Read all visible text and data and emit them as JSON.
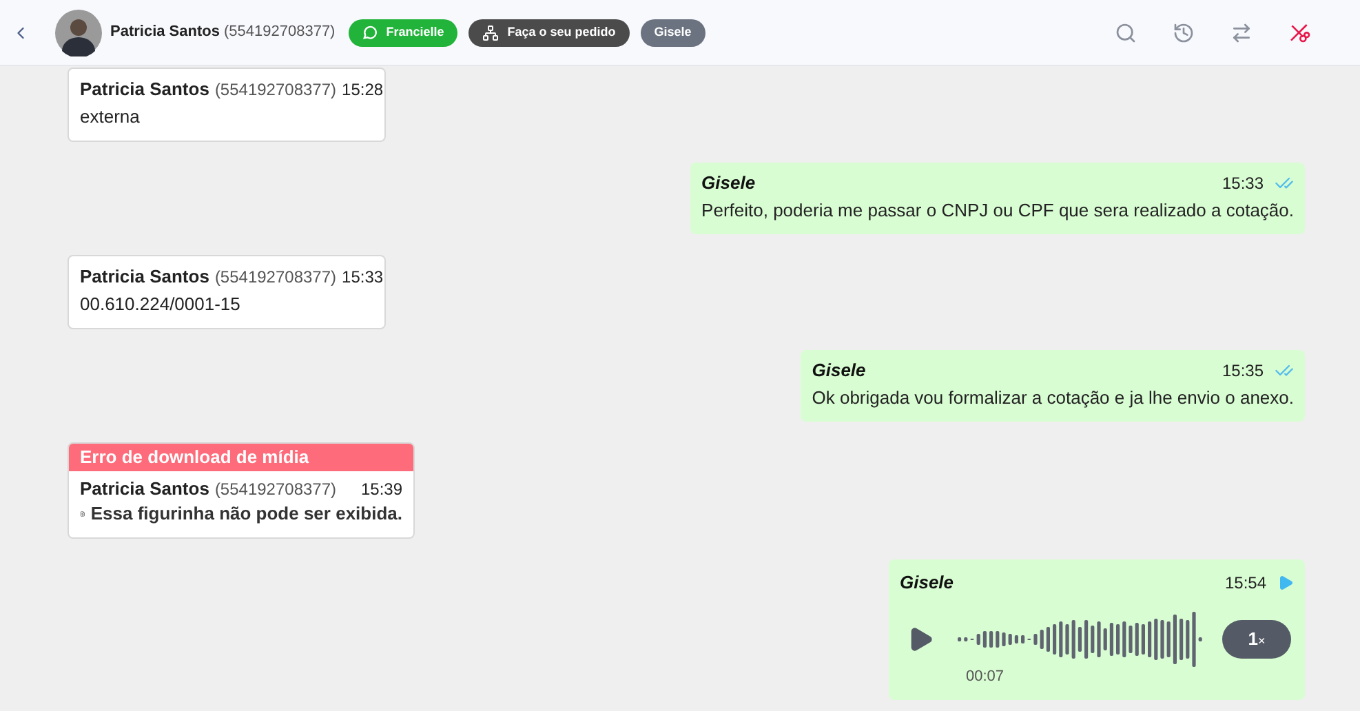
{
  "header": {
    "contact_name": "Patricia Santos",
    "contact_phone": "(554192708377)",
    "tags": [
      {
        "kind": "whatsapp",
        "label": "Francielle",
        "color": "#22b33a"
      },
      {
        "kind": "queue",
        "label": "Faça o seu pedido",
        "color": "#4b4b4b"
      },
      {
        "kind": "plain",
        "label": "Gisele",
        "color": "#6b7280"
      }
    ]
  },
  "messages": [
    {
      "kind": "incoming",
      "sender": "Patricia Santos",
      "phone": "(554192708377)",
      "time": "15:28",
      "text": "externa"
    },
    {
      "kind": "outgoing",
      "sender": "Gisele",
      "time": "15:33",
      "text": "Perfeito, poderia me passar o CNPJ ou CPF que sera realizado a cotação.",
      "read": true
    },
    {
      "kind": "incoming",
      "sender": "Patricia Santos",
      "phone": "(554192708377)",
      "time": "15:33",
      "text": "00.610.224/0001-15"
    },
    {
      "kind": "outgoing",
      "sender": "Gisele",
      "time": "15:35",
      "text": "Ok obrigada vou formalizar a cotação e ja lhe envio o anexo.",
      "read": true
    },
    {
      "kind": "error",
      "banner": "Erro de download de mídia",
      "sender": "Patricia Santos",
      "phone": "(554192708377)",
      "time": "15:39",
      "text": "Essa figurinha não pode ser exibida."
    },
    {
      "kind": "audio",
      "sender": "Gisele",
      "time": "15:54",
      "duration": "00:07",
      "speed": "1",
      "speed_suffix": "×"
    }
  ]
}
